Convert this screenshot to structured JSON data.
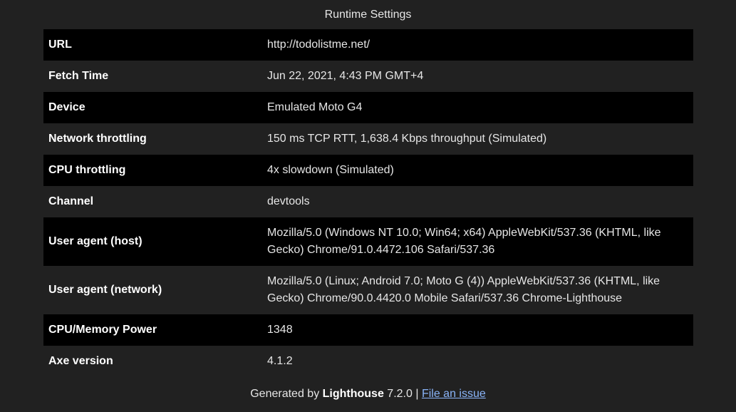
{
  "title": "Runtime Settings",
  "rows": [
    {
      "label": "URL",
      "value": "http://todolistme.net/"
    },
    {
      "label": "Fetch Time",
      "value": "Jun 22, 2021, 4:43 PM GMT+4"
    },
    {
      "label": "Device",
      "value": "Emulated Moto G4"
    },
    {
      "label": "Network throttling",
      "value": "150 ms TCP RTT, 1,638.4 Kbps throughput (Simulated)"
    },
    {
      "label": "CPU throttling",
      "value": "4x slowdown (Simulated)"
    },
    {
      "label": "Channel",
      "value": "devtools"
    },
    {
      "label": "User agent (host)",
      "value": "Mozilla/5.0 (Windows NT 10.0; Win64; x64) AppleWebKit/537.36 (KHTML, like Gecko) Chrome/91.0.4472.106 Safari/537.36"
    },
    {
      "label": "User agent (network)",
      "value": "Mozilla/5.0 (Linux; Android 7.0; Moto G (4)) AppleWebKit/537.36 (KHTML, like Gecko) Chrome/90.0.4420.0 Mobile Safari/537.36 Chrome-Lighthouse"
    },
    {
      "label": "CPU/Memory Power",
      "value": "1348"
    },
    {
      "label": "Axe version",
      "value": "4.1.2"
    }
  ],
  "footer": {
    "prefix": "Generated by ",
    "brand": "Lighthouse",
    "version": " 7.2.0 | ",
    "link": "File an issue"
  },
  "colors": {
    "background": "#212121",
    "row_dark": "#000000",
    "link": "#8ab4f8"
  }
}
